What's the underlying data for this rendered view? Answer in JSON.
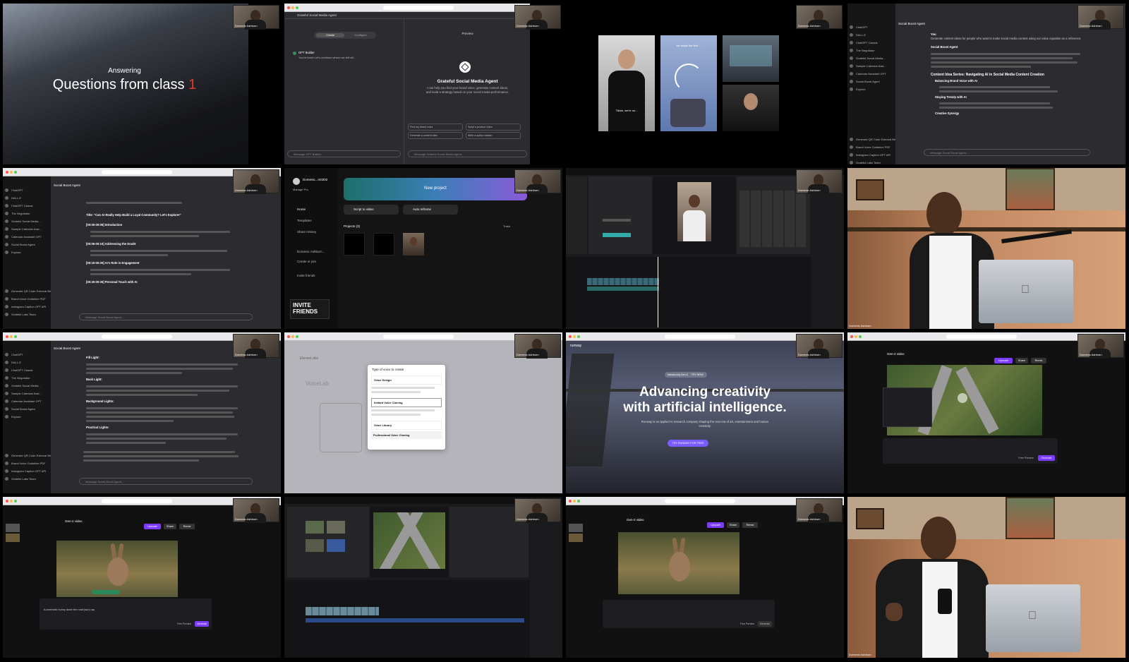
{
  "tile1": {
    "eyebrow": "Answering",
    "title": "Questions from class ",
    "title_accent": "1",
    "accent": "#e8392d"
  },
  "tile2": {
    "header": "Grateful Social Media Agent",
    "tab_create": "Create",
    "tab_configure": "Configure",
    "preview": "Preview",
    "builder_name": "GPT Builder",
    "builder_msg": "You're back! Let's continue where we left off...",
    "agent_name": "Grateful Social Media Agent",
    "agent_desc": "I can help you find your brand voice, generate content ideas, and build a strategy based on your social media performance.",
    "starters": [
      "Find my brand voice",
      "Script a product video",
      "Generate a content idea",
      "Write a quirky caption"
    ],
    "input_left": "Message GPT Builder...",
    "input_right": "Message Grateful Social Media Agent..."
  },
  "tile3": {
    "caption1": "Tiktok, we're on...",
    "caption2": "we made the first ..."
  },
  "tile4": {
    "sidebar": [
      "ChatGPT",
      "DALL-E",
      "ChatGPT Classic",
      "The Negotiator",
      "Grateful Social Media...",
      "Sample Calendar Assi...",
      "Calendar Assistant GPT",
      "Social Boost Agent",
      "Explore"
    ],
    "history": [
      "Generate QR Code External Bri...",
      "Brand Voice Guideline PDF",
      "Instagram Caption GPT API"
    ],
    "footer": "Grateful Labs Team",
    "header": "Social Boost Agent",
    "you": "You",
    "user_msg": "Generate content ideas for people who want to make social media content using our value equation as a reference.",
    "agent": "Social Boost Agent",
    "heading": "Content Idea Series: Navigating AI in Social Media Content Creation",
    "items": [
      "Balancing Brand Voice with AI",
      "Staying Trendy with AI",
      "Creative Synergy"
    ],
    "input": "Message Social Boost Agent..."
  },
  "tile5": {
    "header": "Social Boost Agent",
    "title_line": "Title: \"Can AI Really Help Build a Loyal Community? Let's Explore!\"",
    "sections": [
      "[00:00-00:05] Introduction",
      "[00:05-00:15] Addressing the Doubt",
      "[00:15-00:25] AI's Role in Engagement",
      "[00:25-00:35] Personal Touch with AI"
    ],
    "input": "Message Social Boost Agent..."
  },
  "tile6": {
    "user": "Domenic...m0202",
    "plan": "Manage Pro",
    "nav": [
      "Home",
      "Templates",
      "Share History",
      "Domenic Ashburn...",
      "Create or join",
      "Invite friends"
    ],
    "new_project": "New project",
    "script_to_video": "Script to video",
    "auto_reframe": "Auto reframe",
    "projects": "Projects (3)",
    "trash": "Trash",
    "promo": "INVITE FRIENDS"
  },
  "tile8": {
    "name": "Domenic Ashburn"
  },
  "tile9": {
    "header": "Social Boost Agent",
    "items": [
      "Fill Light:",
      "Back Light:",
      "Background Lights:",
      "Practical Lights:"
    ],
    "input": "Message Social Boost Agent..."
  },
  "tile10": {
    "logo": "ElevenLabs",
    "modal_title": "Type of voice to create",
    "options": [
      "Voice Design",
      "Instant Voice Cloning",
      "Voice Library",
      "Professional Voice Cloning"
    ],
    "bg_title": "VoiceLab"
  },
  "tile11": {
    "logo": "runway",
    "badge": "Introducing Gen-2",
    "badge_cta": "TRY NOW",
    "headline1": "Advancing creativity",
    "headline2": "with artificial intelligence.",
    "sub": "Runway is an applied AI research company shaping the next era of art, entertainment and human creativity.",
    "cta": "TRY RUNWAY FOR FREE"
  },
  "tile12": {
    "title": "Gen-2 video",
    "btn_upscale": "Upscale",
    "btn_share": "Share",
    "btn_remix": "Remix",
    "btn_preview": "Free Preview",
    "btn_generate": "Generate"
  },
  "tile13": {
    "title": "Gen-2 video",
    "btn_upscale": "Upscale",
    "btn_share": "Share",
    "btn_remix": "Remix",
    "prompt": "A cinematic bunny down the road (sun) ray",
    "btn_preview": "Free Preview",
    "btn_generate": "Generate"
  },
  "tile15": {
    "title": "Gen-2 video",
    "btn_upscale": "Upscale",
    "btn_share": "Share",
    "btn_remix": "Remix",
    "btn_preview": "Free Preview",
    "btn_generate": "Generate"
  },
  "tile16": {
    "name": "Domenic Ashburn"
  },
  "cam": {
    "name": "Domenic Ashburn"
  }
}
